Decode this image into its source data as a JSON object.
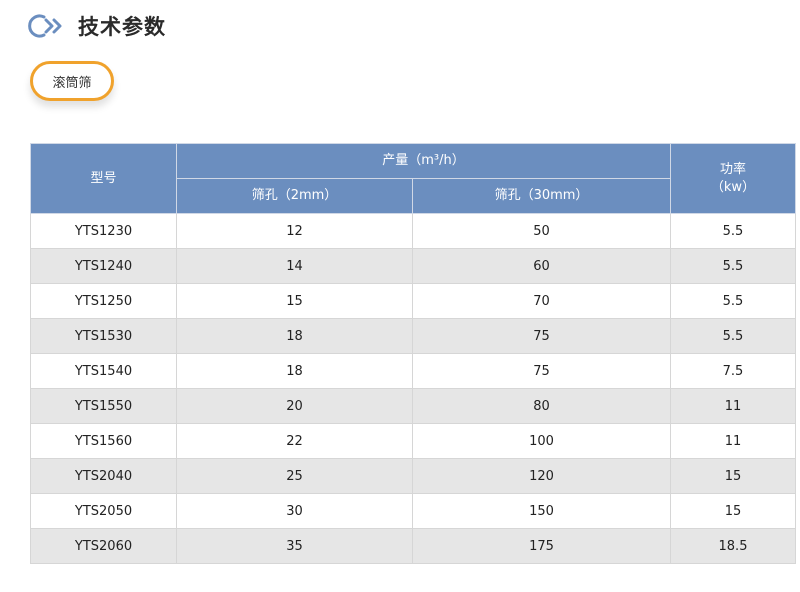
{
  "section": {
    "title": "技术参数"
  },
  "tabs": [
    {
      "label": "滚筒筛"
    }
  ],
  "table": {
    "header": {
      "model": "型号",
      "output": "产量（m³/h）",
      "screen_2mm": "筛孔（2mm）",
      "screen_30mm": "筛孔（30mm）",
      "power_label": "功率",
      "power_unit": "（kw）"
    },
    "rows": [
      [
        "YTS1230",
        "12",
        "50",
        "5.5"
      ],
      [
        "YTS1240",
        "14",
        "60",
        "5.5"
      ],
      [
        "YTS1250",
        "15",
        "70",
        "5.5"
      ],
      [
        "YTS1530",
        "18",
        "75",
        "5.5"
      ],
      [
        "YTS1540",
        "18",
        "75",
        "7.5"
      ],
      [
        "YTS1550",
        "20",
        "80",
        "11"
      ],
      [
        "YTS1560",
        "22",
        "100",
        "11"
      ],
      [
        "YTS2040",
        "25",
        "120",
        "15"
      ],
      [
        "YTS2050",
        "30",
        "150",
        "15"
      ],
      [
        "YTS2060",
        "35",
        "175",
        "18.5"
      ]
    ]
  },
  "colors": {
    "header_bg": "#6b8ebf",
    "tab_border": "#f0a22c",
    "stripe": "#e6e6e6"
  }
}
